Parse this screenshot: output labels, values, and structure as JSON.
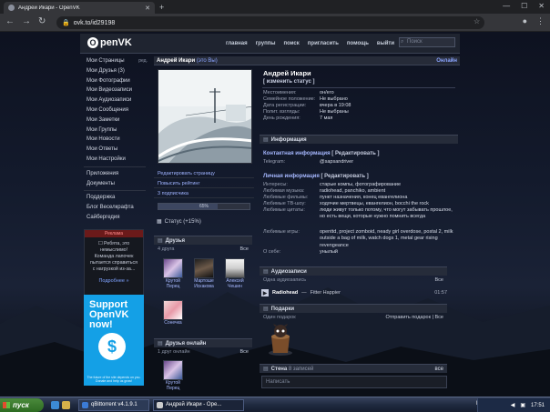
{
  "browser": {
    "tab_title": "Андрей Икари - OpenVK",
    "new_tab": "+",
    "url": "ovk.to/id29198",
    "nav_back": "←",
    "nav_forward": "→",
    "nav_reload": "↻"
  },
  "header": {
    "logo_text": "penVK",
    "logo_mark": "O",
    "nav": [
      "главная",
      "группы",
      "поиск",
      "пригласить",
      "помощь",
      "выйти"
    ],
    "search_placeholder": "Поиск"
  },
  "left_menu": {
    "items": [
      {
        "label": "Мои Страницы",
        "extra": "ред."
      },
      {
        "label": "Мои Друзья (3)"
      },
      {
        "label": "Мои Фотографии"
      },
      {
        "label": "Мои Видеозаписи"
      },
      {
        "label": "Мои Аудиозаписи"
      },
      {
        "label": "Мои Сообщения"
      },
      {
        "label": "Мои Заметки"
      },
      {
        "label": "Мои Группы"
      },
      {
        "label": "Мои Новости"
      },
      {
        "label": "Мои Ответы"
      },
      {
        "label": "Мои Настройки"
      }
    ],
    "items2": [
      "Приложения",
      "Документы"
    ],
    "items3": [
      "Поддержка",
      "Блог Веселкрафта",
      "Сайбергедия"
    ],
    "ad_title": "Реклама",
    "ad_text": "☐ Ребята, это немыслимо! Команда лапочек пытается справиться с нагрузкой из-за...",
    "ad_more": "Подробнее »",
    "support_text": "Support OpenVK now!",
    "support_small": "The future of the site depends on you. Donate and help us grow!"
  },
  "profile": {
    "name": "Андрей Икари",
    "you": "(это Вы)",
    "online": "Онлайн",
    "actions": [
      "Редактировать страницу",
      "Повысить рейтинг",
      "3 подписчика"
    ],
    "rating": "65%",
    "rating_fraction": 0.65,
    "status_link": "Статус (+15%)",
    "friends_title": "Друзья",
    "friends_count": "4 друга",
    "all": "Все",
    "friends": [
      {
        "name": "Крутой Перец"
      },
      {
        "name": "Мартоше Искакова"
      },
      {
        "name": "Алексей Чешин"
      },
      {
        "name": "Сонечка"
      }
    ],
    "online_title": "Друзья онлайн",
    "online_count": "1 друг онлайн",
    "online_friend": "Крутой Перец"
  },
  "info": {
    "full_name": "Андрей Икари",
    "edit_status": "[ изменить статус ]",
    "basic": [
      {
        "k": "Местоимения:",
        "v": "он/его"
      },
      {
        "k": "Семейное положение:",
        "v": "Не выбрано"
      },
      {
        "k": "Дата регистрации:",
        "v": "вчера в 19:08"
      },
      {
        "k": "Полит. взгляды:",
        "v": "Не выбраны"
      },
      {
        "k": "День рождения:",
        "v": "7 мая"
      }
    ],
    "info_head": "Информация",
    "contact_title": "Контактная информация",
    "edit_label": "[ Редактировать ]",
    "contact": [
      {
        "k": "Telegram:",
        "v": "@sapsandriver"
      }
    ],
    "personal_title": "Личная информация",
    "personal": [
      {
        "k": "Интересы:",
        "v": "старые компы, фотографирование"
      },
      {
        "k": "Любимая музыка:",
        "v": "radiohead, panchiko, ambient"
      },
      {
        "k": "Любимые фильмы:",
        "v": "пункт назначения, конец евангелиона"
      },
      {
        "k": "Любимые ТВ-шоу:",
        "v": "ходячие мертвецы, евангелион, bocchi the rock"
      },
      {
        "k": "Любимые цитаты:",
        "v": "люди живут только потому, что могут забывать прошлое, но есть вещи, которые нужно помнить всегда"
      },
      {
        "k": "Любимые игры:",
        "v": "openttd, project zomboid, neady girl overdose, postal 2, milk outside a bag of milk, watch dogs 1, metal gear rising revengeance"
      },
      {
        "k": "О себе:",
        "v": "унылый"
      }
    ],
    "audio_head": "Аудиозаписи",
    "audio_count": "Одна аудиозапись",
    "audio_all": "Все",
    "track": {
      "artist": "Radiohead",
      "sep": " — ",
      "title": "Fitter Happier",
      "duration": "01:57"
    },
    "gifts_head": "Подарки",
    "gifts_count": "Один подарок",
    "send_gift": "Отправить подарок",
    "gifts_all": "Все",
    "wall_head": "Стена",
    "wall_count": "8 записей",
    "wall_all": "все",
    "wall_placeholder": "Написать"
  },
  "taskbar": {
    "start": "пуск",
    "tasks": [
      "qBittorrent v4.1.9.1",
      "Андрей Икари - Ope..."
    ],
    "lang": "EN",
    "clock": "17:51"
  },
  "colors": {
    "accent": "#8aa4ff",
    "panel": "#1f2430",
    "support_blue": "#14a0e6"
  }
}
